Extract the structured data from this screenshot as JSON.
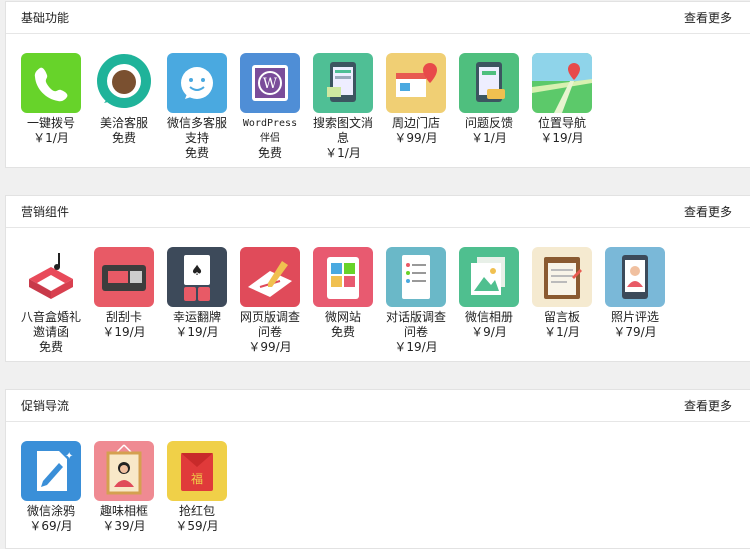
{
  "sections": [
    {
      "title": "基础功能",
      "more": "查看更多",
      "items": [
        {
          "name": "一键拨号",
          "price": "￥1/月",
          "icon": "phone-icon",
          "color": "#67d32a"
        },
        {
          "name": "美洽客服",
          "price": "免费",
          "icon": "chat-bubble-icon",
          "color": "#1fb39a"
        },
        {
          "name": "微信多客服支持",
          "price": "免费",
          "icon": "smiley-icon",
          "color": "#4aa9e0"
        },
        {
          "name": "WordPress伴侣",
          "price": "免费",
          "icon": "wordpress-icon",
          "color": "#4f8ed6"
        },
        {
          "name": "搜索图文消息",
          "price": "￥1/月",
          "icon": "phone-news-icon",
          "color": "#4fbf95"
        },
        {
          "name": "周边门店",
          "price": "￥99/月",
          "icon": "store-pin-icon",
          "color": "#f0cf74"
        },
        {
          "name": "问题反馈",
          "price": "￥1/月",
          "icon": "phone-feedback-icon",
          "color": "#4fbf7e"
        },
        {
          "name": "位置导航",
          "price": "￥19/月",
          "icon": "map-navigation-icon",
          "color": "#5cc96a"
        }
      ]
    },
    {
      "title": "营销组件",
      "more": "查看更多",
      "items": [
        {
          "name": "八音盒婚礼邀请函",
          "price": "免费",
          "icon": "music-box-icon",
          "color": "#ffffff"
        },
        {
          "name": "刮刮卡",
          "price": "￥19/月",
          "icon": "scratch-card-icon",
          "color": "#e85a66"
        },
        {
          "name": "幸运翻牌",
          "price": "￥19/月",
          "icon": "playing-cards-icon",
          "color": "#3d4a5a"
        },
        {
          "name": "网页版调查问卷",
          "price": "￥99/月",
          "icon": "survey-pen-icon",
          "color": "#e04b5a"
        },
        {
          "name": "微网站",
          "price": "免费",
          "icon": "micro-site-icon",
          "color": "#e85a70"
        },
        {
          "name": "对话版调查问卷",
          "price": "￥19/月",
          "icon": "dialog-survey-icon",
          "color": "#6ab8c8"
        },
        {
          "name": "微信相册",
          "price": "￥9/月",
          "icon": "photo-album-icon",
          "color": "#4fbf8f"
        },
        {
          "name": "留言板",
          "price": "￥1/月",
          "icon": "message-board-icon",
          "color": "#f5ead0"
        },
        {
          "name": "照片评选",
          "price": "￥79/月",
          "icon": "photo-vote-icon",
          "color": "#7ab8d8"
        }
      ]
    },
    {
      "title": "促销导流",
      "more": "查看更多",
      "items": [
        {
          "name": "微信涂鸦",
          "price": "￥69/月",
          "icon": "doodle-icon",
          "color": "#3a8fd8"
        },
        {
          "name": "趣味相框",
          "price": "￥39/月",
          "icon": "photo-frame-icon",
          "color": "#ef8a92"
        },
        {
          "name": "抢红包",
          "price": "￥59/月",
          "icon": "red-envelope-icon",
          "color": "#f0d048"
        }
      ]
    }
  ],
  "glyphs": {
    "fu": "福"
  }
}
